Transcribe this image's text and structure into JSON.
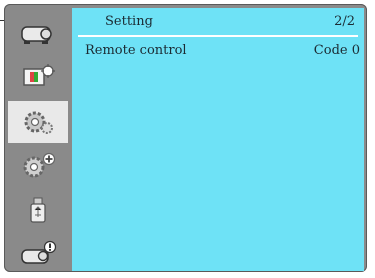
{
  "header": {
    "title": "Setting",
    "page_indicator": "2/2"
  },
  "items": [
    {
      "label": "Remote control",
      "value": "Code 0"
    }
  ],
  "sidebar": {
    "tabs": [
      {
        "icon": "projector-icon"
      },
      {
        "icon": "image-settings-icon"
      },
      {
        "icon": "gear-settings-icon",
        "active": true
      },
      {
        "icon": "gear-plus-icon"
      },
      {
        "icon": "usb-icon"
      },
      {
        "icon": "projector-info-icon"
      }
    ]
  },
  "colors": {
    "panel_bg": "#6ee2f6",
    "frame": "#8a8a8a",
    "active_tab": "#e9e9e9"
  }
}
